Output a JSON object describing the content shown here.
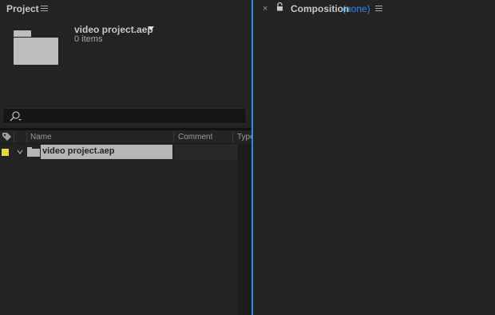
{
  "colors": {
    "label_yellow": "#e2da3b",
    "active_border": "#2d8ceb",
    "link_blue": "#2d8ceb",
    "panel_bg": "#232323"
  },
  "project_panel": {
    "title": "Project",
    "menu_icon": "hamburger-icon",
    "file_name": "video project.aep",
    "item_count": "0 items",
    "thumbnail_icon": "folder-icon",
    "search": {
      "icon": "search-icon",
      "value": "",
      "placeholder": ""
    },
    "columns": [
      {
        "label": ""
      },
      {
        "label": "Name"
      },
      {
        "label": "Comment"
      },
      {
        "label": "Type"
      }
    ],
    "rows": [
      {
        "label_color": "#e2da3b",
        "name": "video project.aep",
        "comment": "",
        "type": ""
      }
    ]
  },
  "composition_panel": {
    "close_label": "×",
    "title": "Composition",
    "title_suffix": "(none)",
    "menu_icon": "hamburger-icon"
  }
}
